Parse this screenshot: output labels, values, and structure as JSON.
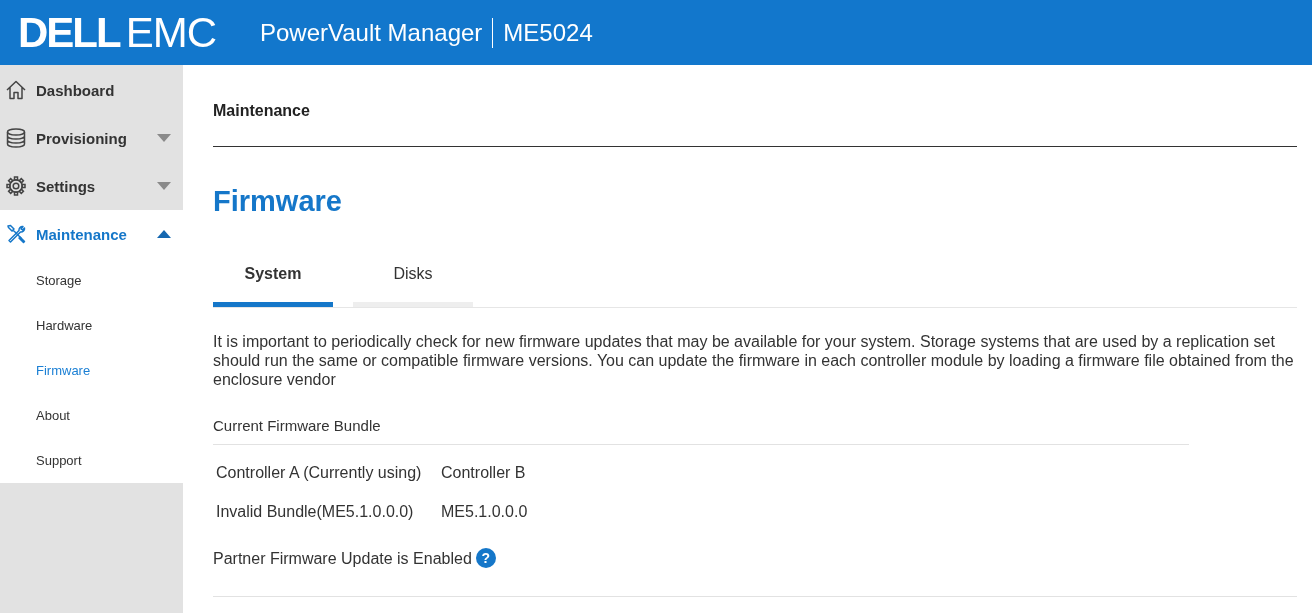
{
  "header": {
    "logo": "**DELL**EMC",
    "title": "PowerVault Manager",
    "model": "ME5024"
  },
  "sidebar": {
    "items": [
      {
        "label": "Dashboard",
        "kind": "link",
        "selected": false
      },
      {
        "label": "Provisioning",
        "kind": "group",
        "selected": false,
        "expanded": false
      },
      {
        "label": "Settings",
        "kind": "group",
        "selected": false,
        "expanded": false
      },
      {
        "label": "Maintenance",
        "kind": "group",
        "selected": true,
        "expanded": true,
        "children": [
          {
            "label": "Storage",
            "selected": false
          },
          {
            "label": "Hardware",
            "selected": false
          },
          {
            "label": "Firmware",
            "selected": true
          },
          {
            "label": "About",
            "selected": false
          },
          {
            "label": "Support",
            "selected": false
          }
        ]
      }
    ]
  },
  "breadcrumb": "Maintenance",
  "page_title": "Firmware",
  "tabs": [
    {
      "label": "System",
      "selected": true
    },
    {
      "label": "Disks",
      "selected": false
    }
  ],
  "description": "It is important to periodically check for new firmware updates that may be available for your system. Storage systems that are used by a replication set should run the same or compatible firmware versions. You can update the firmware in each controller module by loading a firmware file obtained from the enclosure vendor",
  "bundle": {
    "title": "Current Firmware Bundle",
    "columns": [
      "Controller A (Currently using)",
      "Controller B"
    ],
    "rows": [
      [
        "Invalid Bundle(ME5.1.0.0.0)",
        "ME5.1.0.0.0"
      ]
    ]
  },
  "partner_update": {
    "label": "Partner Firmware Update is Enabled",
    "help": "?"
  }
}
